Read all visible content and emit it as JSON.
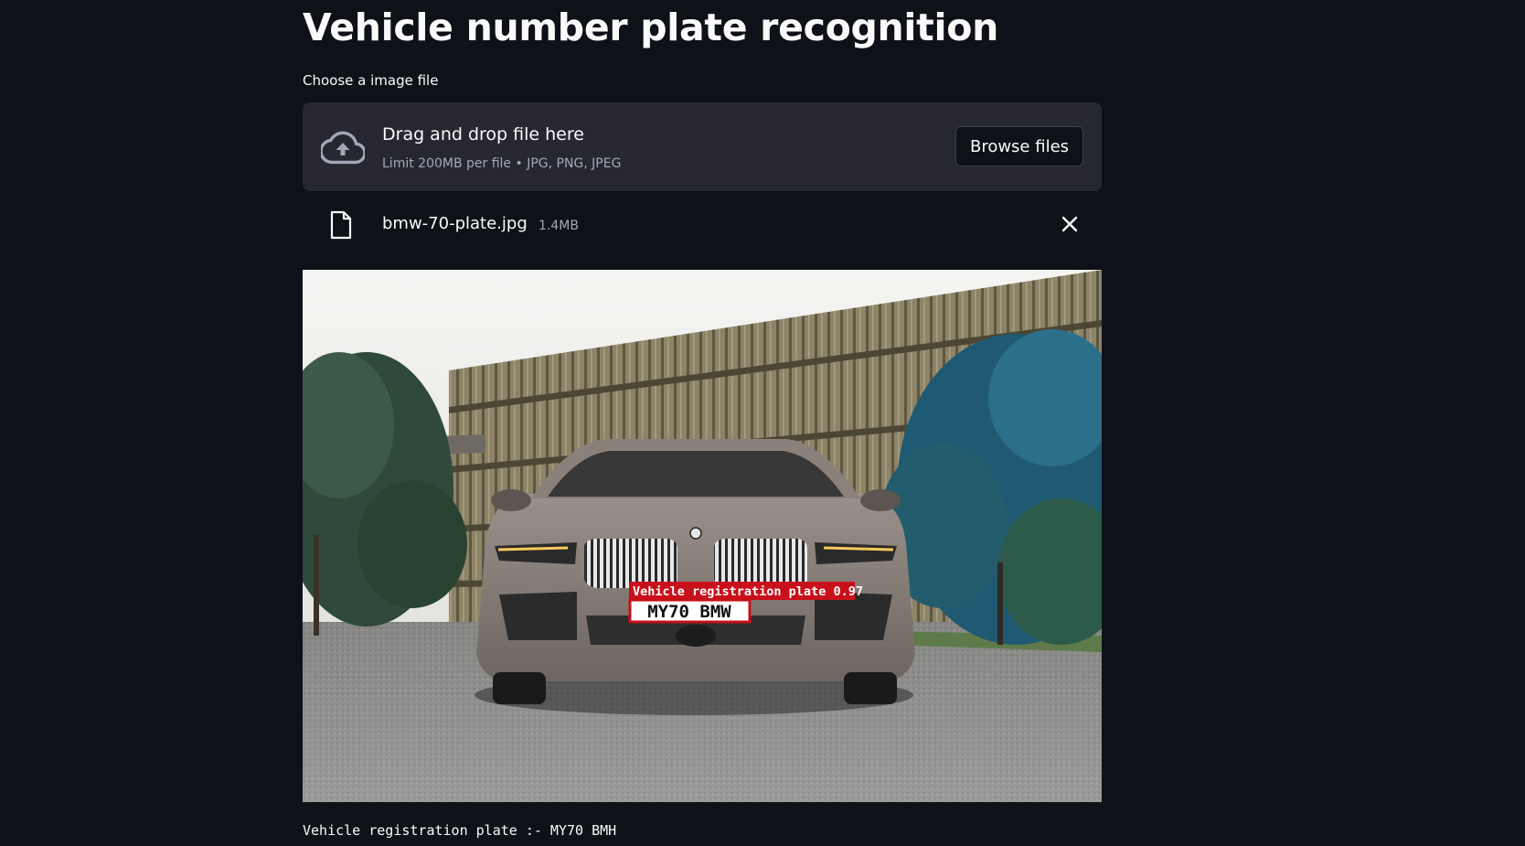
{
  "page": {
    "title": "Vehicle number plate recognition"
  },
  "uploader": {
    "label": "Choose a image file",
    "drop_title": "Drag and drop file here",
    "drop_subtitle": "Limit 200MB per file • JPG, PNG, JPEG",
    "browse_label": "Browse files",
    "icon": "cloud-upload-icon"
  },
  "uploaded_file": {
    "name": "bmw-70-plate.jpg",
    "size": "1.4MB",
    "icon": "file-icon",
    "remove_icon": "close-icon"
  },
  "detection": {
    "box_label": "Vehicle registration plate 0.97",
    "plate_on_image": "MY70 BMW",
    "box_color": "#c8101a"
  },
  "result": {
    "text": "Vehicle registration plate :- MY70 BMH"
  },
  "colors": {
    "background": "#0e1117",
    "surface": "#262730",
    "text": "#fafafa",
    "muted": "#a3a8b8"
  }
}
